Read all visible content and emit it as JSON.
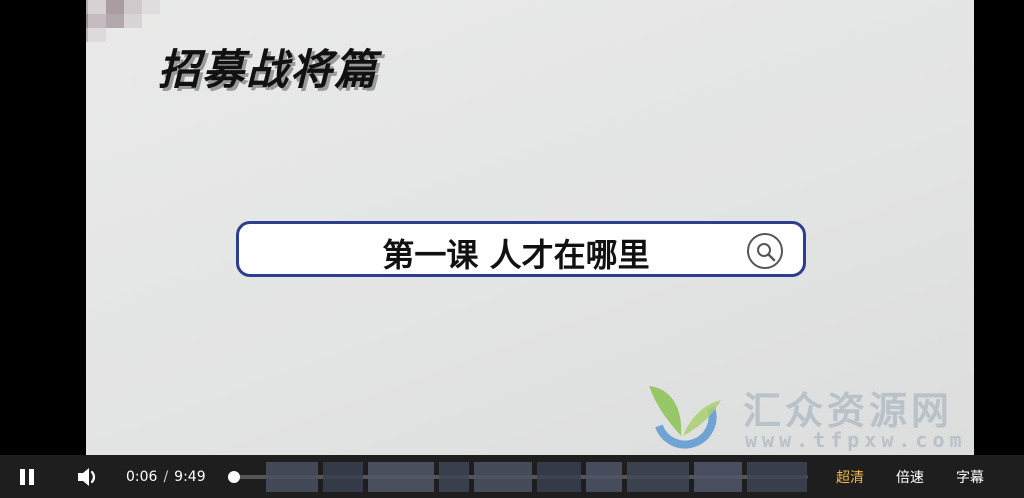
{
  "video": {
    "title_text": "招募战将篇",
    "lesson_text": "第一课 人才在哪里",
    "watermark": {
      "name": "汇众资源网",
      "url": "www.tfpxw.com",
      "colors": {
        "leaf_green": "#8fc45a",
        "ring_blue": "#4a8fd0"
      }
    }
  },
  "controls": {
    "current_time": "0:06",
    "separator": "/",
    "duration": "9:49",
    "progress_fraction": 0.011,
    "quality_label": "超清",
    "speed_label": "倍速",
    "subtitle_label": "字幕",
    "colors": {
      "active_quality": "#f2b64a",
      "bar_bg": "#1e1e1e"
    }
  }
}
